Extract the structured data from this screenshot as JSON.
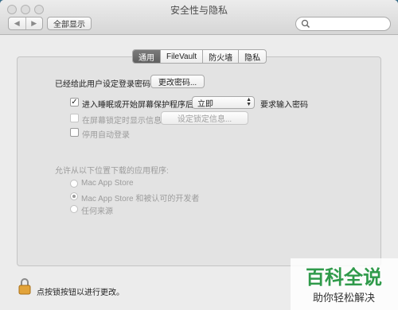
{
  "window": {
    "title": "安全性与隐私"
  },
  "toolbar": {
    "back_icon": "left-arrow-icon",
    "forward_icon": "right-arrow-icon",
    "show_all_label": "全部显示",
    "search_placeholder": ""
  },
  "tabs": [
    {
      "label": "通用",
      "active": true
    },
    {
      "label": "FileVault",
      "active": false
    },
    {
      "label": "防火墙",
      "active": false
    },
    {
      "label": "隐私",
      "active": false
    }
  ],
  "general": {
    "password_set_label": "已经给此用户设定登录密码",
    "change_password_button": "更改密码...",
    "require_password": {
      "checked": true,
      "prefix_label": "进入睡眠或开始屏幕保护程序后",
      "selected_value": "立即",
      "suffix_label": "要求输入密码"
    },
    "show_message": {
      "checked": false,
      "label": "在屏幕锁定时显示信息",
      "button": "设定锁定信息..."
    },
    "disable_auto_login": {
      "checked": false,
      "label": "停用自动登录"
    },
    "download_section_label": "允许从以下位置下载的应用程序:",
    "download_options": [
      {
        "label": "Mac App Store",
        "selected": false
      },
      {
        "label": "Mac App Store 和被认可的开发者",
        "selected": true
      },
      {
        "label": "任何来源",
        "selected": false
      }
    ]
  },
  "footer": {
    "lock_text": "点按锁按钮以进行更改。"
  },
  "watermark": {
    "title": "百科全说",
    "subtitle": "助你轻松解决"
  },
  "colors": {
    "accent_green": "#2f9a4a",
    "tab_active_bg": "#6b6b6b",
    "desktop_bg": "#3a6f8a"
  }
}
